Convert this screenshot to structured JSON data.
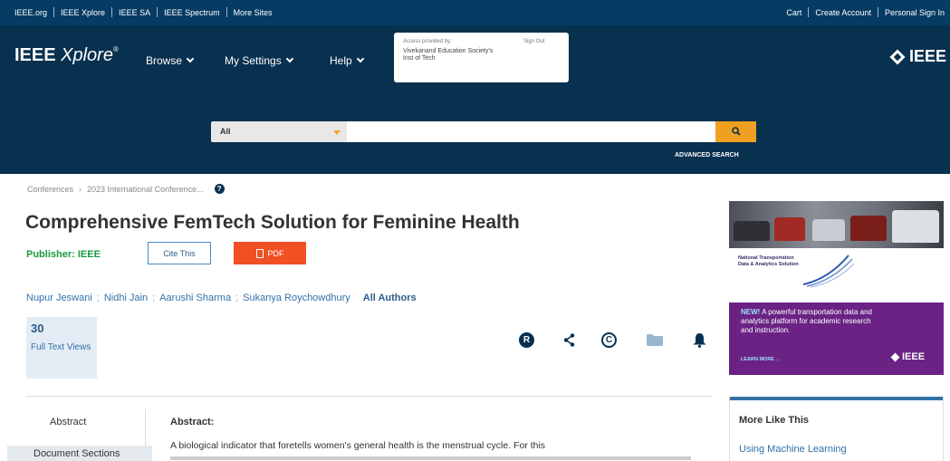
{
  "topbar": {
    "left_links": [
      "IEEE.org",
      "IEEE Xplore",
      "IEEE SA",
      "IEEE Spectrum",
      "More Sites"
    ],
    "right_links": [
      "Cart",
      "Create Account",
      "Personal Sign In"
    ]
  },
  "header": {
    "logo_bold": "IEEE",
    "logo_italic": "Xplore",
    "logo_mark": "®",
    "nav": [
      "Browse",
      "My Settings",
      "Help"
    ],
    "access_label": "Access provided by:",
    "access_org": "Vivekanand Education Society's Inst of Tech",
    "sign_out": "Sign Out",
    "ieee_brand": "IEEE"
  },
  "search": {
    "scope": "All",
    "placeholder": "",
    "advanced": "ADVANCED SEARCH"
  },
  "breadcrumb": {
    "items": [
      "Conferences",
      "2023 International Conference..."
    ],
    "separator": "›"
  },
  "document": {
    "title": "Comprehensive FemTech Solution for Feminine Health",
    "publisher": "Publisher: IEEE",
    "cite": "Cite This",
    "pdf": "PDF",
    "authors": [
      "Nupur Jeswani",
      "Nidhi Jain",
      "Aarushi Sharma",
      "Sukanya Roychowdhury"
    ],
    "all_authors": "All Authors",
    "metrics_count": "30",
    "metrics_label": "Full Text Views",
    "actions": [
      "rights-icon",
      "share-icon",
      "copyright-icon",
      "folder-icon",
      "bell-icon"
    ]
  },
  "sidebar": {
    "tabs": [
      "Abstract",
      "Document Sections"
    ]
  },
  "abstract": {
    "heading": "Abstract:",
    "first_line": "A biological indicator that foretells women's general health is the menstrual cycle. For this"
  },
  "ad": {
    "sponsor": "National Transportation Data & Analytics Solution",
    "new_tag": "NEW!",
    "body": " A powerful transportation data and analytics platform for academic research and instruction.",
    "cta": "LEARN MORE →",
    "brand": "IEEE"
  },
  "more_like_this": {
    "heading": "More Like This",
    "first_item": "Using Machine Learning"
  },
  "colors": {
    "topbar": "#063b63",
    "header": "#08304f",
    "search_button": "#f0a020",
    "pdf_button": "#f05024",
    "publisher": "#1a9a3c",
    "link": "#3271a8",
    "ad_background": "#6a2384"
  }
}
